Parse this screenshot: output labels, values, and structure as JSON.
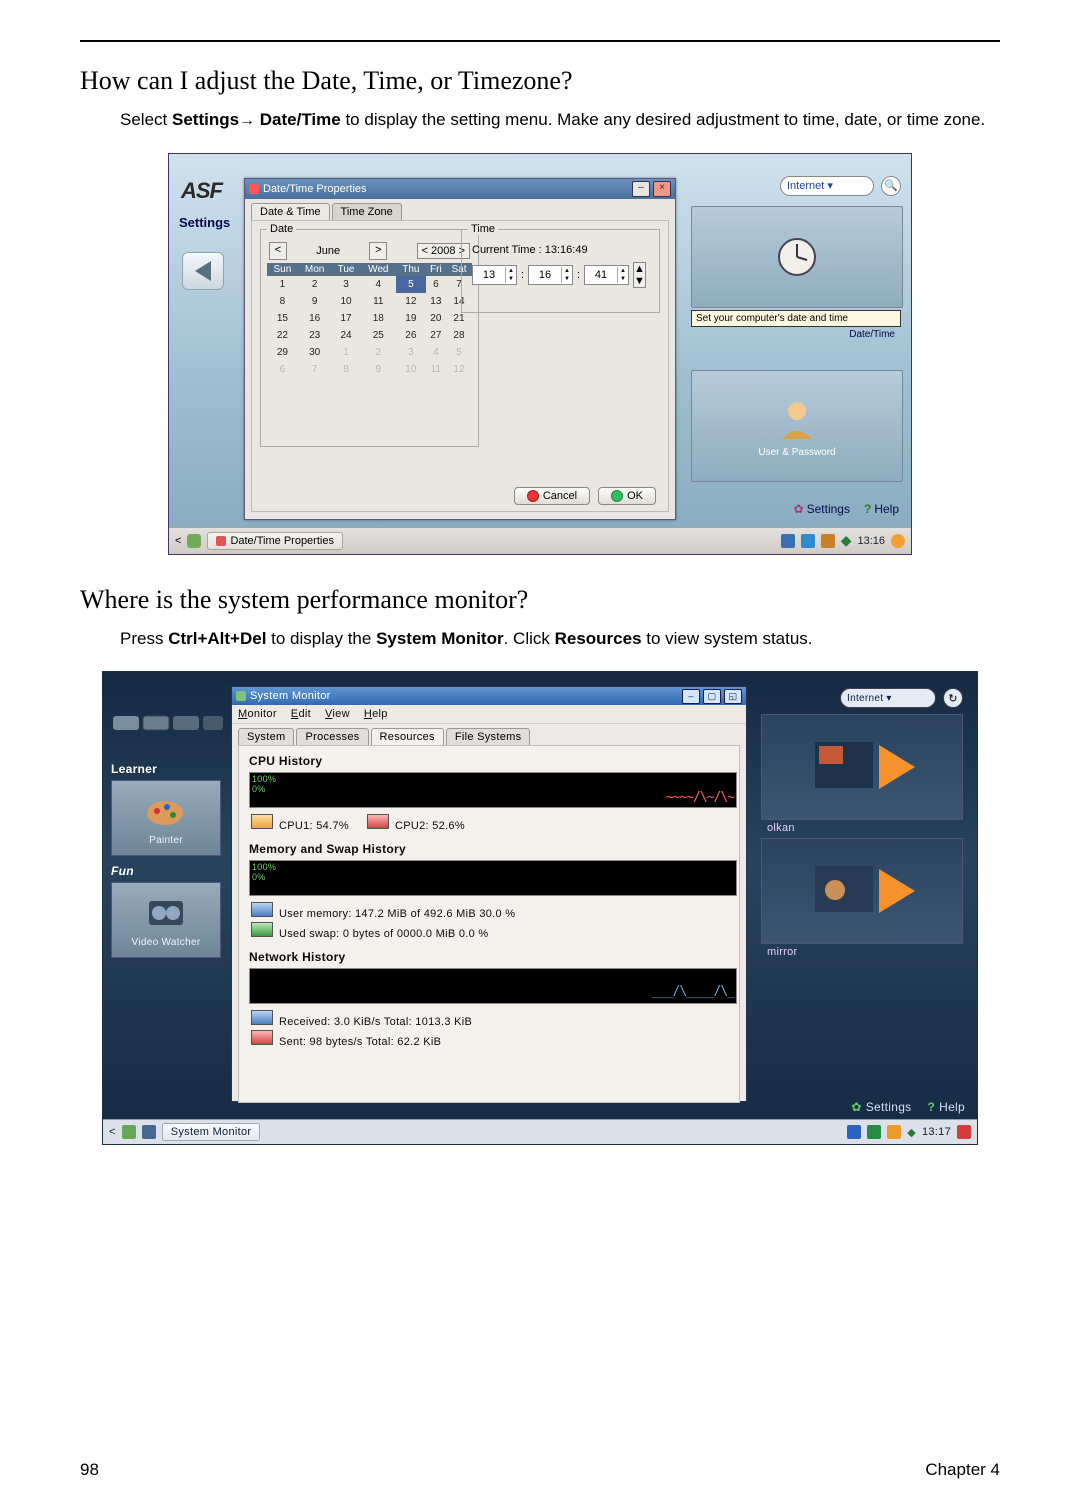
{
  "headings": {
    "q1": "How can I adjust the Date, Time, or Timezone?",
    "q2": "Where is the system performance monitor?"
  },
  "body": {
    "p1a": "Select ",
    "p1b": "Settings",
    "p1arrow": "→",
    "p1c": "Date/Time",
    "p1d": " to display the setting menu. Make any desired adjustment to time, date, or time zone.",
    "p2a": "Press ",
    "p2b": "Ctrl+Alt+Del",
    "p2c": " to display the ",
    "p2d": "System Monitor",
    "p2e": ". Click ",
    "p2f": "Resources",
    "p2g": " to view system status."
  },
  "fig1": {
    "logo": "ASF",
    "settings": "Settings",
    "window_title": "Date/Time Properties",
    "tabs": {
      "dt": "Date & Time",
      "tz": "Time Zone"
    },
    "date_group": "Date",
    "time_group": "Time",
    "month": "June",
    "year_btn": "< 2008 >",
    "dow": [
      "Sun",
      "Mon",
      "Tue",
      "Wed",
      "Thu",
      "Fri",
      "Sat"
    ],
    "weeks": [
      [
        "1",
        "2",
        "3",
        "4",
        "5",
        "6",
        "7"
      ],
      [
        "8",
        "9",
        "10",
        "11",
        "12",
        "13",
        "14"
      ],
      [
        "15",
        "16",
        "17",
        "18",
        "19",
        "20",
        "21"
      ],
      [
        "22",
        "23",
        "24",
        "25",
        "26",
        "27",
        "28"
      ],
      [
        "29",
        "30",
        "1",
        "2",
        "3",
        "4",
        "5"
      ],
      [
        "6",
        "7",
        "8",
        "9",
        "10",
        "11",
        "12"
      ]
    ],
    "selected": "5",
    "current_time_lbl": "Current Time : 13:16:49",
    "time_h": "13",
    "time_m": "16",
    "time_s": "41",
    "btn_cancel": "Cancel",
    "btn_ok": "OK",
    "right": {
      "search": "Internet ▾",
      "tooltip": "Set your computer's date and time",
      "tile1_label": "Date/Time",
      "tile2_label": "User & Password"
    },
    "bottom_links": {
      "settings": "Settings",
      "help": "Help"
    },
    "taskbar": {
      "task": "Date/Time Properties",
      "clock": "13:16"
    }
  },
  "fig2": {
    "window_title": "System Monitor",
    "menu": [
      "Monitor",
      "Edit",
      "View",
      "Help"
    ],
    "tabs": [
      "System",
      "Processes",
      "Resources",
      "File Systems"
    ],
    "left_column_title": "Learner",
    "left_tiles": [
      {
        "label": "Painter"
      },
      {
        "label": "Fun"
      },
      {
        "label": "Video Watcher"
      }
    ],
    "sections": {
      "cpu_title": "CPU History",
      "cpu_chart_label": "100%\n0%",
      "cpu_legend": [
        {
          "label": "CPU1:  54.7%",
          "sw": "org"
        },
        {
          "label": "CPU2:  52.6%",
          "sw": "red"
        }
      ],
      "mem_title": "Memory and Swap History",
      "mem_legend": [
        {
          "label": "User memory:  147.2 MiB  of  492.6 MiB    30.0 %",
          "sw": "blu"
        },
        {
          "label": "Used swap:     0 bytes   of  0000.0 MiB    0.0 %",
          "sw": "grn"
        }
      ],
      "net_title": "Network History",
      "net_legend": [
        {
          "label": "Received:  3.0 KiB/s       Total:  1013.3 KiB",
          "sw": "blu"
        },
        {
          "label": "Sent:      98 bytes/s      Total:  62.2 KiB",
          "sw": "red"
        }
      ]
    },
    "right": {
      "search": "Internet ▾",
      "tile1_label": "olkan",
      "tile2_label": "mirror"
    },
    "bottom_links": {
      "settings": "Settings",
      "help": "Help"
    },
    "taskbar": {
      "task": "System Monitor",
      "clock": "13:17"
    }
  },
  "footer": {
    "page": "98",
    "chapter": "Chapter 4"
  }
}
